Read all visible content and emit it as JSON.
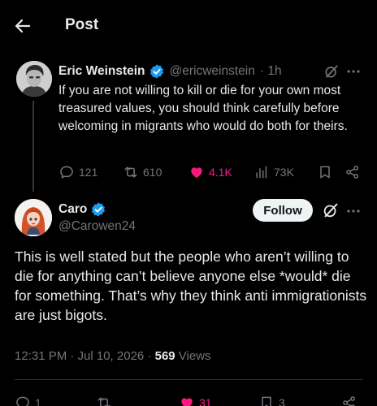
{
  "header": {
    "title": "Post"
  },
  "parent_tweet": {
    "name": "Eric Weinstein",
    "handle": "@ericweinstein",
    "time": "· 1h",
    "text": "If you are not willing to kill or die for your own most treasured values, you should think carefully before welcoming in migrants who would do both for theirs.",
    "replies": "121",
    "reposts": "610",
    "likes": "4.1K",
    "views": "73K",
    "like_color": "#f91880"
  },
  "reply_tweet": {
    "name": "Caro",
    "handle": "@Carowen24",
    "follow_label": "Follow",
    "text": "This is well stated but the people who aren’t willing to die for anything can’t believe anyone else *would* die for something.  That’s why they think anti immigrationists are just bigots.",
    "timestamp": "12:31 PM · Jul 10, 2026 · ",
    "views_count": "569",
    "views_label": " Views",
    "replies": "1",
    "likes": "31",
    "bookmarks": "3"
  },
  "colors": {
    "verified": "#1d9bf0",
    "muted": "#71767b",
    "like": "#f91880"
  },
  "icons": [
    "back-arrow-icon",
    "verified-icon",
    "grok-icon",
    "more-icon",
    "reply-icon",
    "repost-icon",
    "like-icon",
    "views-icon",
    "bookmark-icon",
    "share-icon"
  ]
}
